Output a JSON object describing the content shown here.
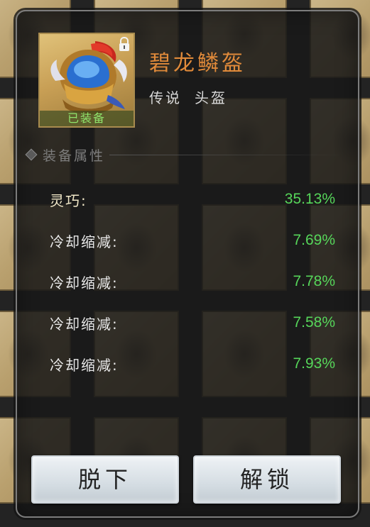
{
  "item": {
    "name": "碧龙鳞盔",
    "rarity": "传说",
    "slot": "头盔",
    "equipped_label": "已装备",
    "icon": "helmet-icon",
    "lock_icon": "lock-icon",
    "name_color": "#e08a3a"
  },
  "section": {
    "title": "装备属性",
    "icon": "diamond-icon"
  },
  "attributes": [
    {
      "label": "灵巧:",
      "value": "35.13%"
    },
    {
      "label": "冷却缩减:",
      "value": "7.69%"
    },
    {
      "label": "冷却缩减:",
      "value": "7.78%"
    },
    {
      "label": "冷却缩减:",
      "value": "7.58%"
    },
    {
      "label": "冷却缩减:",
      "value": "7.93%"
    }
  ],
  "buttons": {
    "unequip_label": "脱下",
    "unlock_label": "解锁"
  },
  "colors": {
    "value_green": "#56d65a",
    "equipped_green": "#8fe36b",
    "name_orange": "#e08a3a"
  }
}
